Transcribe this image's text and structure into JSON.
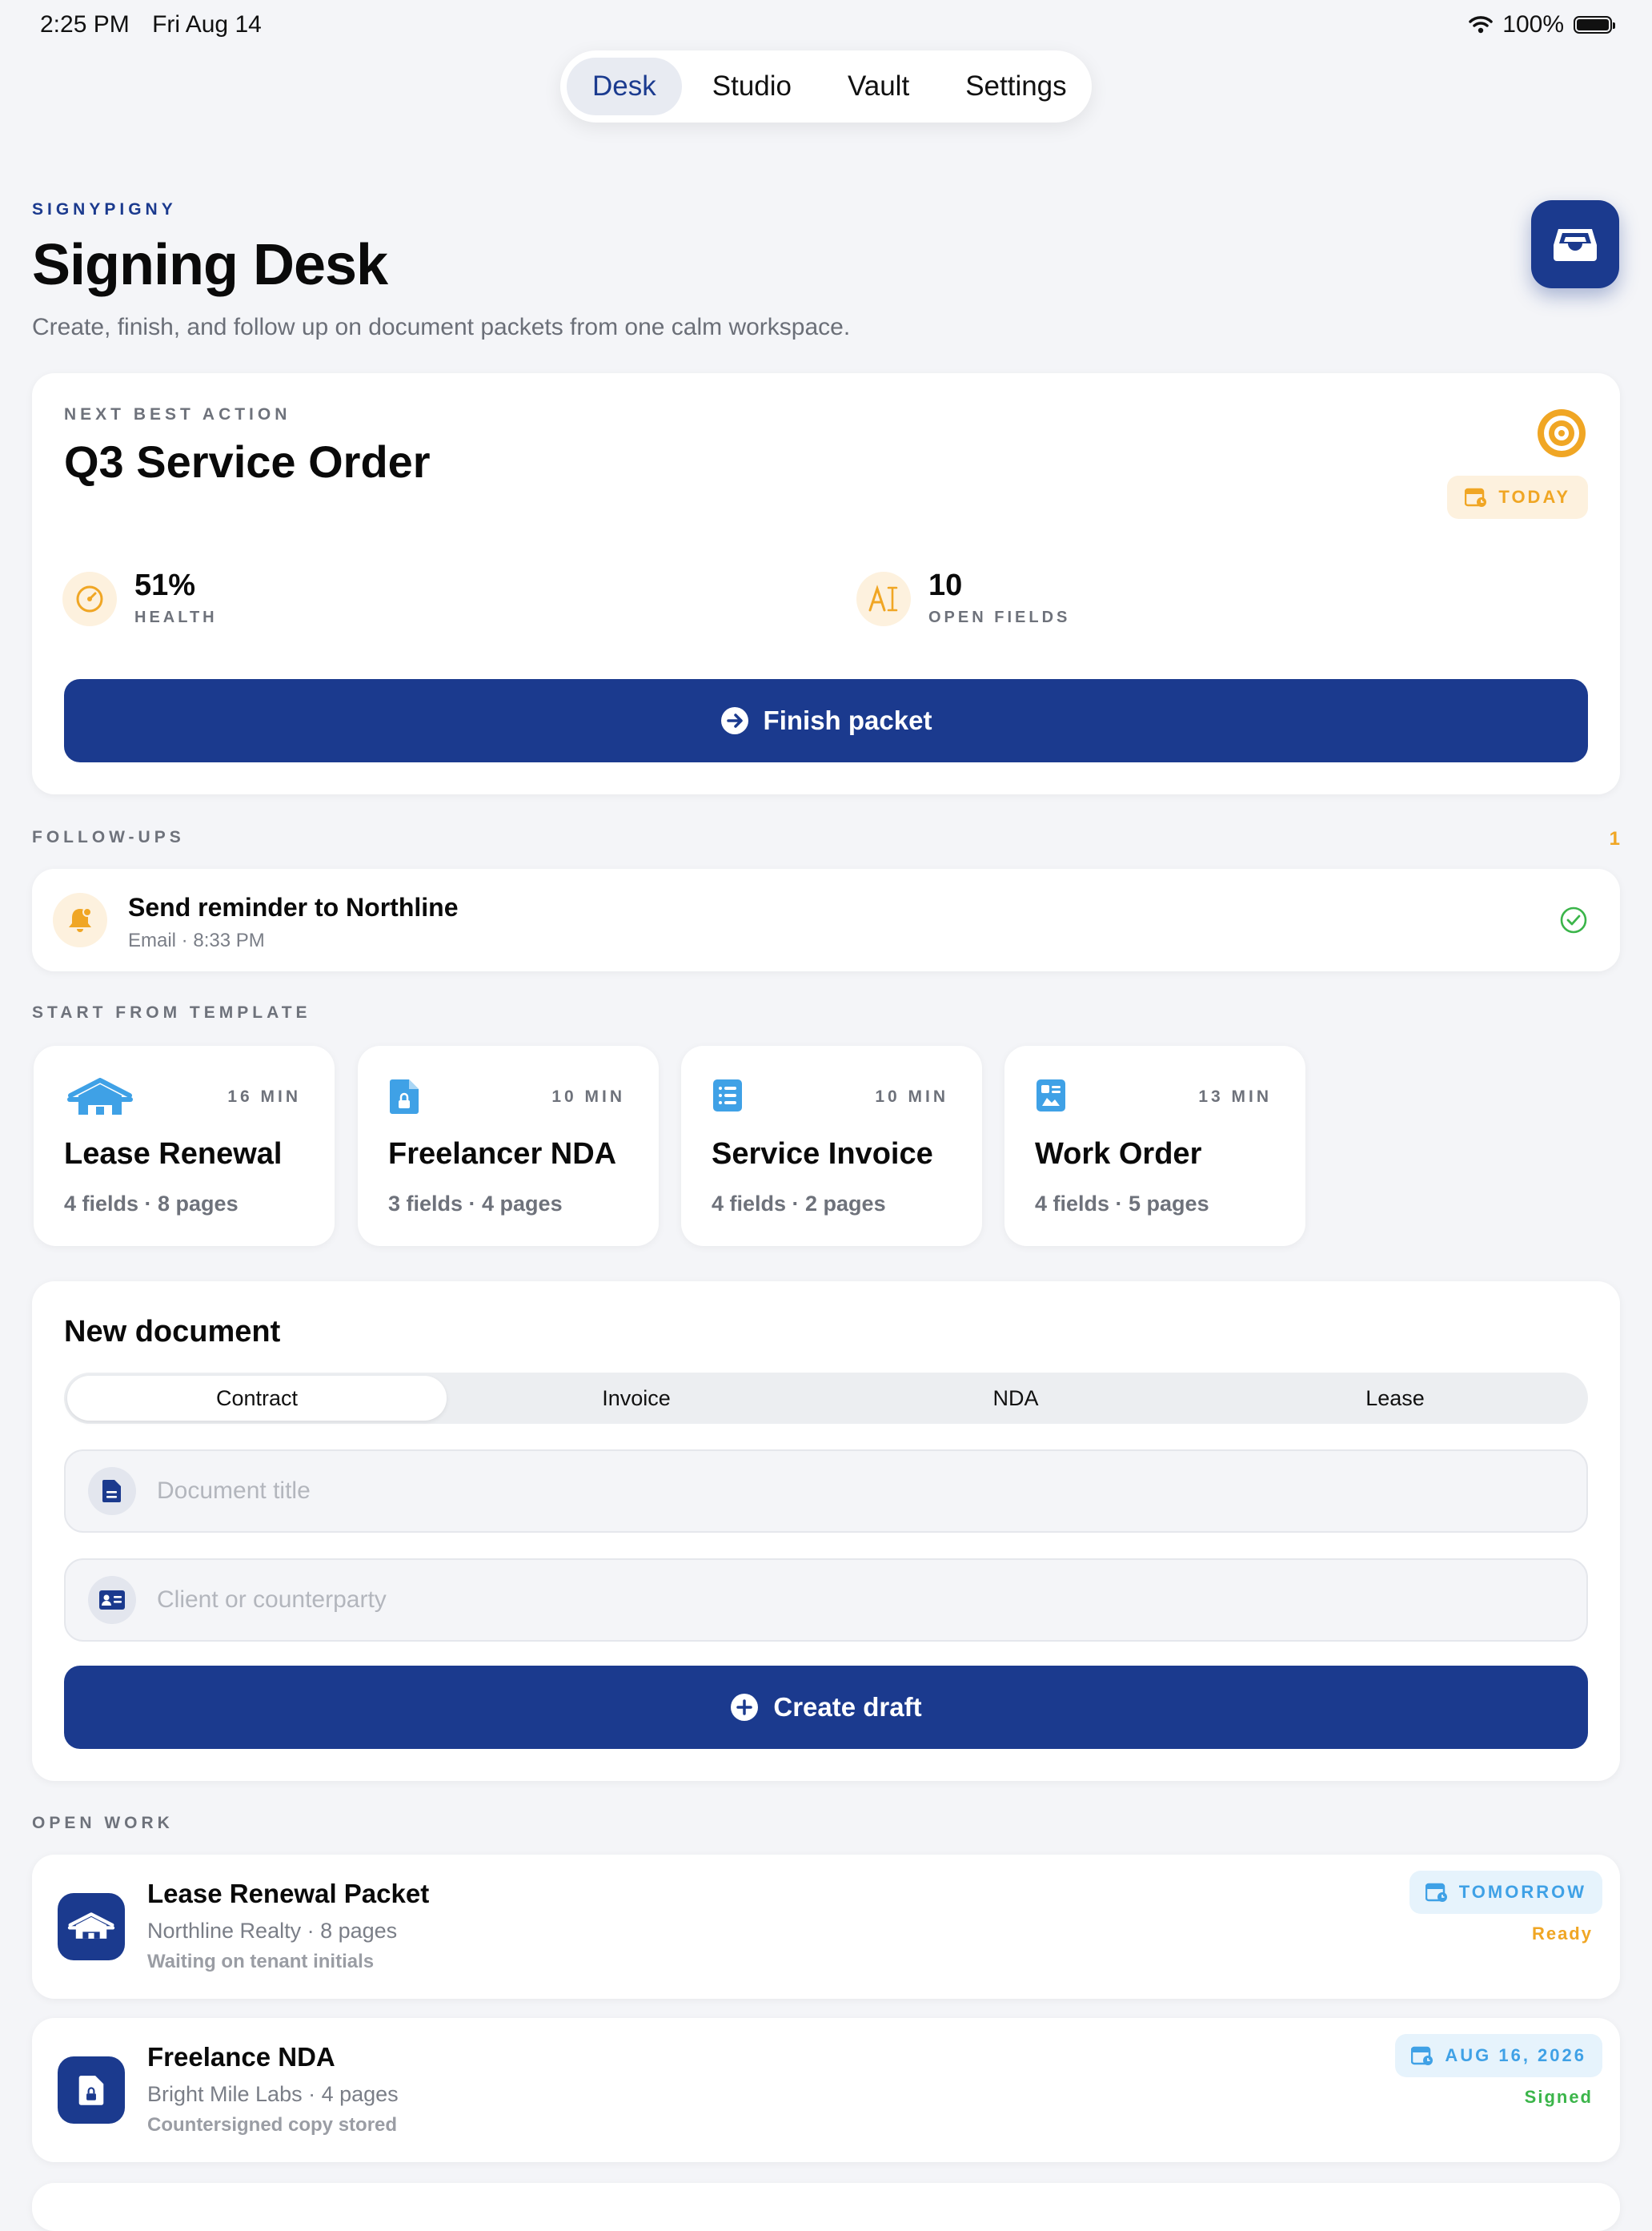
{
  "status_bar": {
    "time": "2:25 PM",
    "date": "Fri Aug 14",
    "battery": "100%"
  },
  "tabs": [
    {
      "label": "Desk",
      "active": true
    },
    {
      "label": "Studio",
      "active": false
    },
    {
      "label": "Vault",
      "active": false
    },
    {
      "label": "Settings",
      "active": false
    }
  ],
  "header": {
    "brand": "SIGNYPIGNY",
    "title": "Signing Desk",
    "subtitle": "Create, finish, and follow up on document packets from one calm workspace."
  },
  "next_action": {
    "eyebrow": "NEXT BEST ACTION",
    "title": "Q3 Service Order",
    "badge": "TODAY",
    "health_value": "51%",
    "health_label": "HEALTH",
    "fields_value": "10",
    "fields_label": "OPEN FIELDS",
    "button": "Finish packet"
  },
  "followups": {
    "label": "FOLLOW-UPS",
    "count": "1",
    "items": [
      {
        "title": "Send reminder to Northline",
        "meta": "Email · 8:33 PM"
      }
    ]
  },
  "templates": {
    "label": "START FROM TEMPLATE",
    "items": [
      {
        "duration": "16 MIN",
        "title": "Lease Renewal",
        "meta": "4 fields · 8 pages",
        "icon": "house-icon"
      },
      {
        "duration": "10 MIN",
        "title": "Freelancer NDA",
        "meta": "3 fields · 4 pages",
        "icon": "locked-doc-icon"
      },
      {
        "duration": "10 MIN",
        "title": "Service Invoice",
        "meta": "4 fields · 2 pages",
        "icon": "list-doc-icon"
      },
      {
        "duration": "13 MIN",
        "title": "Work Order",
        "meta": "4 fields · 5 pages",
        "icon": "clipboard-icon"
      }
    ]
  },
  "new_document": {
    "title": "New document",
    "types": [
      "Contract",
      "Invoice",
      "NDA",
      "Lease"
    ],
    "selected_type": "Contract",
    "title_placeholder": "Document title",
    "client_placeholder": "Client or counterparty",
    "button": "Create draft"
  },
  "open_work": {
    "label": "OPEN WORK",
    "items": [
      {
        "title": "Lease Renewal Packet",
        "meta": "Northline Realty · 8 pages",
        "note": "Waiting on tenant initials",
        "due": "TOMORROW",
        "status": "Ready",
        "status_color": "#f0a624"
      },
      {
        "title": "Freelance NDA",
        "meta": "Bright Mile Labs · 4 pages",
        "note": "Countersigned copy stored",
        "due": "AUG 16, 2026",
        "status": "Signed",
        "status_color": "#3bb54a"
      }
    ]
  },
  "colors": {
    "primary": "#1b3a8e",
    "accent": "#f0a624",
    "info": "#3fa1e6",
    "success": "#3bb54a"
  }
}
